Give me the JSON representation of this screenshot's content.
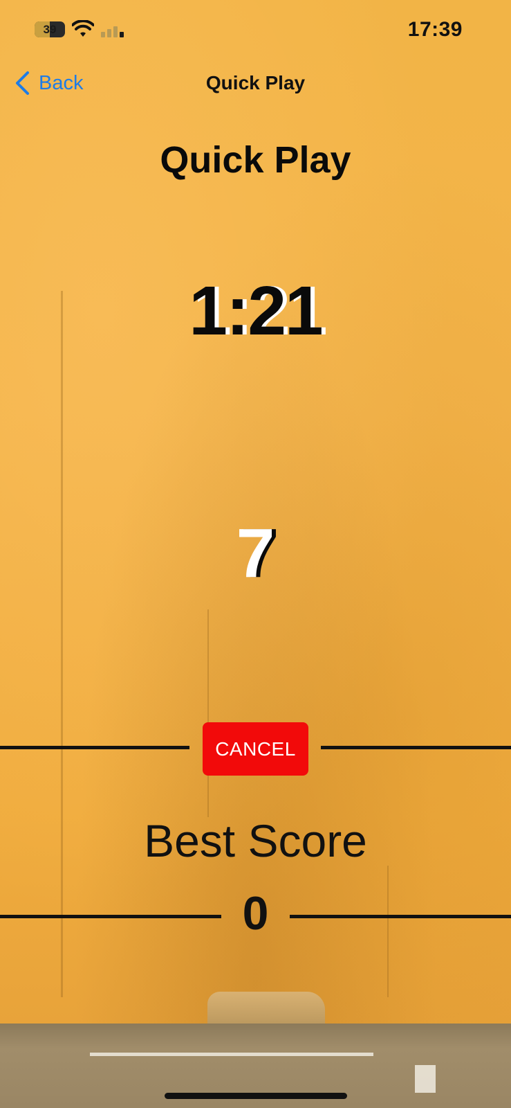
{
  "status_bar": {
    "battery_level": "39",
    "time": "17:39"
  },
  "nav": {
    "back_label": "Back",
    "title": "Quick Play"
  },
  "game": {
    "title": "Quick Play",
    "timer": "1:21",
    "count": "7",
    "cancel_label": "CANCEL"
  },
  "best": {
    "label": "Best Score",
    "value": "0"
  },
  "colors": {
    "background": "#f2b040",
    "accent_blue": "#1e7ce6",
    "cancel_red": "#f20a0a"
  }
}
